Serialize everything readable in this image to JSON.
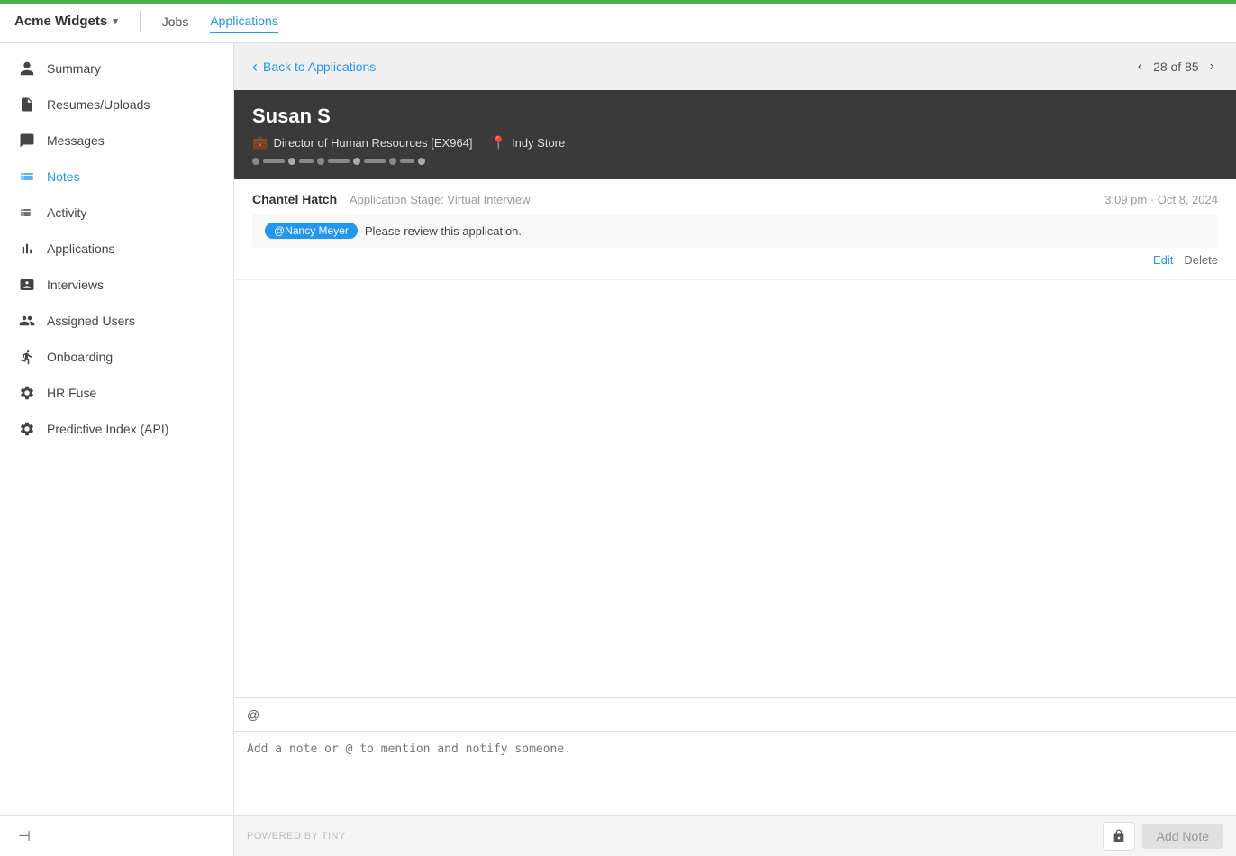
{
  "green_bar": true,
  "top_nav": {
    "brand": "Acme Widgets",
    "chevron": "▾",
    "jobs_label": "Jobs",
    "applications_label": "Applications"
  },
  "sidebar": {
    "items": [
      {
        "id": "summary",
        "label": "Summary",
        "icon": "person"
      },
      {
        "id": "resumes",
        "label": "Resumes/Uploads",
        "icon": "document"
      },
      {
        "id": "messages",
        "label": "Messages",
        "icon": "chat"
      },
      {
        "id": "notes",
        "label": "Notes",
        "icon": "list",
        "active": true
      },
      {
        "id": "activity",
        "label": "Activity",
        "icon": "list-bullet"
      },
      {
        "id": "applications",
        "label": "Applications",
        "icon": "bar-chart"
      },
      {
        "id": "interviews",
        "label": "Interviews",
        "icon": "person-card"
      },
      {
        "id": "assigned-users",
        "label": "Assigned Users",
        "icon": "people"
      },
      {
        "id": "onboarding",
        "label": "Onboarding",
        "icon": "walk"
      },
      {
        "id": "hr-fuse",
        "label": "HR Fuse",
        "icon": "gear"
      },
      {
        "id": "predictive-index",
        "label": "Predictive Index (API)",
        "icon": "gear"
      }
    ],
    "collapse_label": "Collapse"
  },
  "sub_header": {
    "back_label": "Back to Applications",
    "pagination": {
      "current": "28",
      "total": "85",
      "display": "28 of 85"
    }
  },
  "candidate": {
    "name": "Susan S",
    "job_title": "Director of Human Resources [EX964]",
    "location": "Indy Store"
  },
  "note": {
    "author": "Chantel Hatch",
    "stage": "Application Stage: Virtual Interview",
    "timestamp": "3:09 pm · Oct 8, 2024",
    "mention": "@Nancy Meyer",
    "body": "Please review this application.",
    "edit_label": "Edit",
    "delete_label": "Delete"
  },
  "editor": {
    "mention_symbol": "@",
    "placeholder": "Add a note or @ to mention and notify someone.",
    "powered_by": "POWERED BY TINY",
    "add_note_label": "Add Note"
  }
}
